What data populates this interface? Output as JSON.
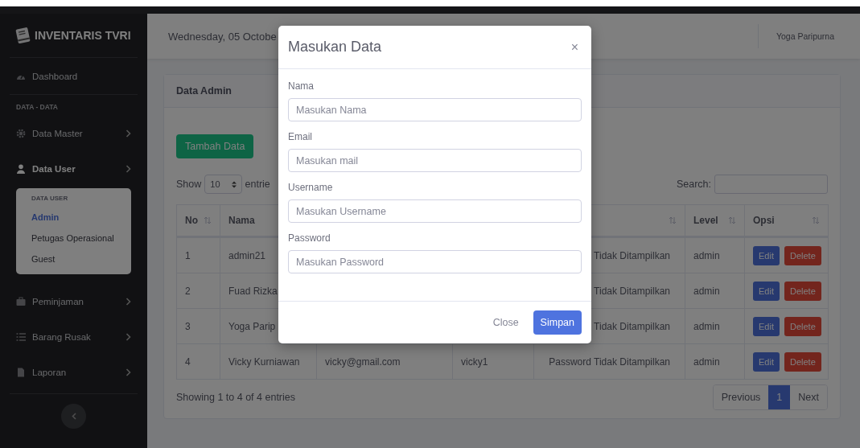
{
  "sidebar": {
    "brand": "INVENTARIS TVRI",
    "items": [
      {
        "kind": "link",
        "label": "Dashboard"
      },
      {
        "kind": "heading",
        "label": "DATA - DATA"
      },
      {
        "kind": "menu",
        "label": "Data Master",
        "expanded": false
      },
      {
        "kind": "menu",
        "label": "Data User",
        "expanded": true,
        "submenu": {
          "heading": "DATA USER",
          "items": [
            {
              "label": "Admin",
              "selected": true
            },
            {
              "label": "Petugas Operasional",
              "selected": false
            },
            {
              "label": "Guest",
              "selected": false
            }
          ]
        }
      },
      {
        "kind": "menu",
        "label": "Peminjaman",
        "expanded": false
      },
      {
        "kind": "menu",
        "label": "Barang Rusak",
        "expanded": false
      },
      {
        "kind": "menu",
        "label": "Laporan",
        "expanded": false
      }
    ]
  },
  "topbar": {
    "date": "Wednesday, 05 Octobe",
    "user": "Yoga Paripurna"
  },
  "card": {
    "title": "Data Admin",
    "add_button": "Tambah Data",
    "show_label": "Show",
    "page_size": "10",
    "entries_label": "entrie",
    "search_label": "Search:",
    "columns": [
      "No",
      "Nama",
      null,
      null,
      null,
      "Level",
      "Opsi"
    ],
    "rows": [
      {
        "cells": [
          "1",
          "admin21",
          null,
          null,
          "Tidak Ditampilkan",
          "admin"
        ],
        "actions": [
          "Edit",
          "Delete"
        ]
      },
      {
        "cells": [
          "2",
          "Fuad Rizka",
          null,
          null,
          "Tidak Ditampilkan",
          "admin"
        ],
        "actions": [
          "Edit",
          "Delete"
        ]
      },
      {
        "cells": [
          "3",
          "Yoga Parip",
          null,
          null,
          "Tidak Ditampilkan",
          "admin"
        ],
        "actions": [
          "Edit",
          "Delete"
        ]
      },
      {
        "cells": [
          "4",
          "Vicky Kurniawan",
          "vicky@gmail.com",
          "vicky1",
          "Password Tidak Ditampilkan",
          "admin"
        ],
        "actions": [
          "Edit",
          "Delete"
        ]
      }
    ],
    "info": "Showing 1 to 4 of 4 entries",
    "pagination": [
      {
        "label": "Previous",
        "selected": false
      },
      {
        "label": "1",
        "selected": true
      },
      {
        "label": "Next",
        "selected": false
      }
    ]
  },
  "modal": {
    "title": "Masukan Data",
    "close_icon": "×",
    "fields": [
      {
        "label": "Nama",
        "placeholder": "Masukan Nama"
      },
      {
        "label": "Email",
        "placeholder": "Masukan mail"
      },
      {
        "label": "Username",
        "placeholder": "Masukan Username"
      },
      {
        "label": "Password",
        "placeholder": "Masukan Password"
      }
    ],
    "buttons": [
      {
        "kind": "secondary",
        "label": "Close"
      },
      {
        "kind": "primary",
        "label": "Simpan"
      }
    ]
  }
}
